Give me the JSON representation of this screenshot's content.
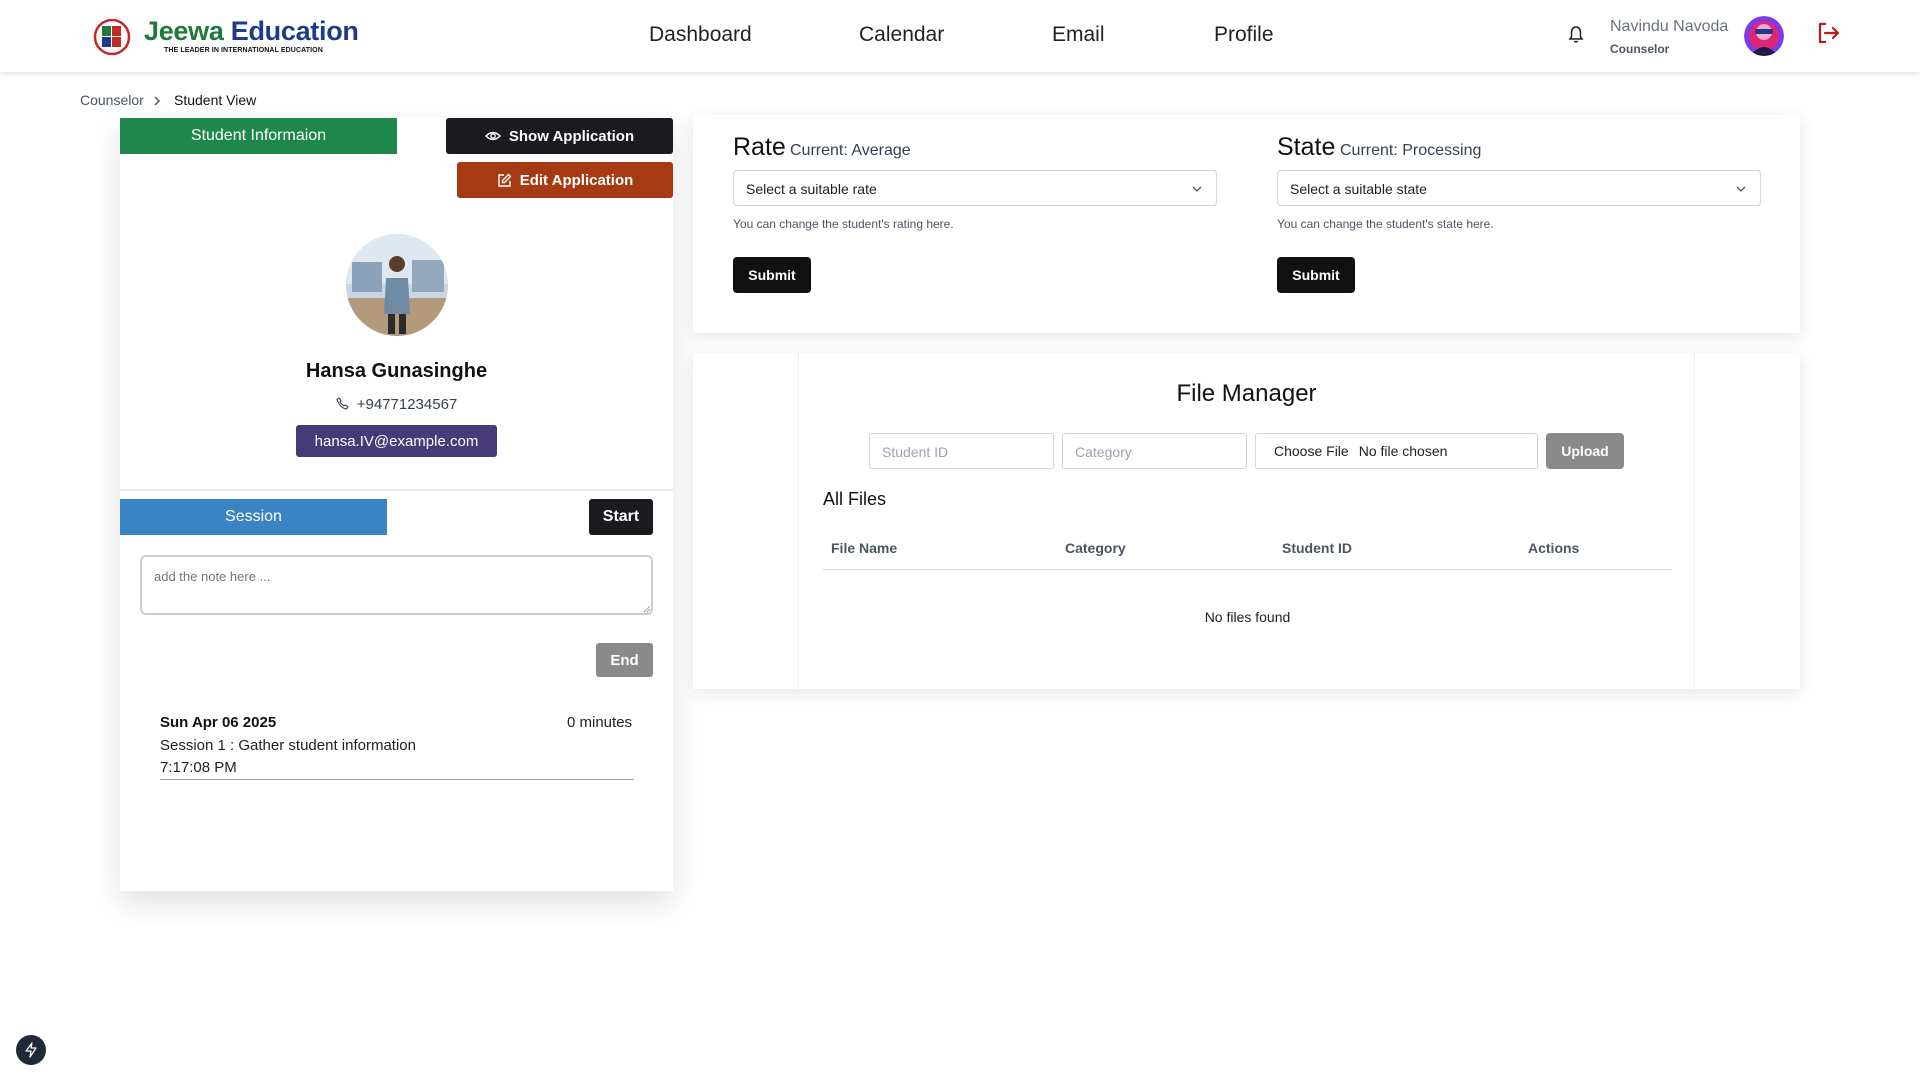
{
  "header": {
    "logo": {
      "brand_main": "Jeewa",
      "brand_accent": "Education",
      "tagline": "THE LEADER IN INTERNATIONAL EDUCATION"
    },
    "nav": [
      {
        "label": "Dashboard"
      },
      {
        "label": "Calendar"
      },
      {
        "label": "Email"
      },
      {
        "label": "Profile"
      }
    ],
    "user": {
      "name": "Navindu Navoda",
      "role": "Counselor"
    },
    "icons": {
      "notifications": "bell-icon",
      "logout": "logout-icon"
    }
  },
  "breadcrumb": {
    "parent": "Counselor",
    "current": "Student View"
  },
  "student": {
    "tab_label": "Student Informaion",
    "show_application_label": "Show Application",
    "edit_application_label": "Edit Application",
    "name": "Hansa Gunasinghe",
    "phone": "+94771234567",
    "email": "hansa.IV@example.com"
  },
  "session": {
    "tab_label": "Session",
    "start_label": "Start",
    "note_placeholder": "add the note here ...",
    "end_label": "End",
    "entries": [
      {
        "date": "Sun Apr 06 2025",
        "duration": "0 minutes",
        "description": "Session 1 : Gather student information",
        "time": "7:17:08 PM"
      }
    ]
  },
  "rate": {
    "label": "Rate",
    "current": "Current: Average",
    "select_placeholder": "Select a suitable rate",
    "hint": "You can change the student's rating here.",
    "submit_label": "Submit"
  },
  "state": {
    "label": "State",
    "current": "Current: Processing",
    "select_placeholder": "Select a suitable state",
    "hint": "You can change the student's state here.",
    "submit_label": "Submit"
  },
  "file_manager": {
    "title": "File Manager",
    "student_id_placeholder": "Student ID",
    "category_placeholder": "Category",
    "choose_file_label": "Choose File",
    "no_file_label": "No file chosen",
    "upload_label": "Upload",
    "all_files_label": "All Files",
    "columns": [
      "File Name",
      "Category",
      "Student ID",
      "Actions"
    ],
    "empty_message": "No files found"
  },
  "colors": {
    "student_tab": "#1e874b",
    "session_tab": "#3a83c4",
    "edit_button": "#a63a12",
    "email_badge": "#463a78",
    "logout_icon": "#b91c1c"
  }
}
